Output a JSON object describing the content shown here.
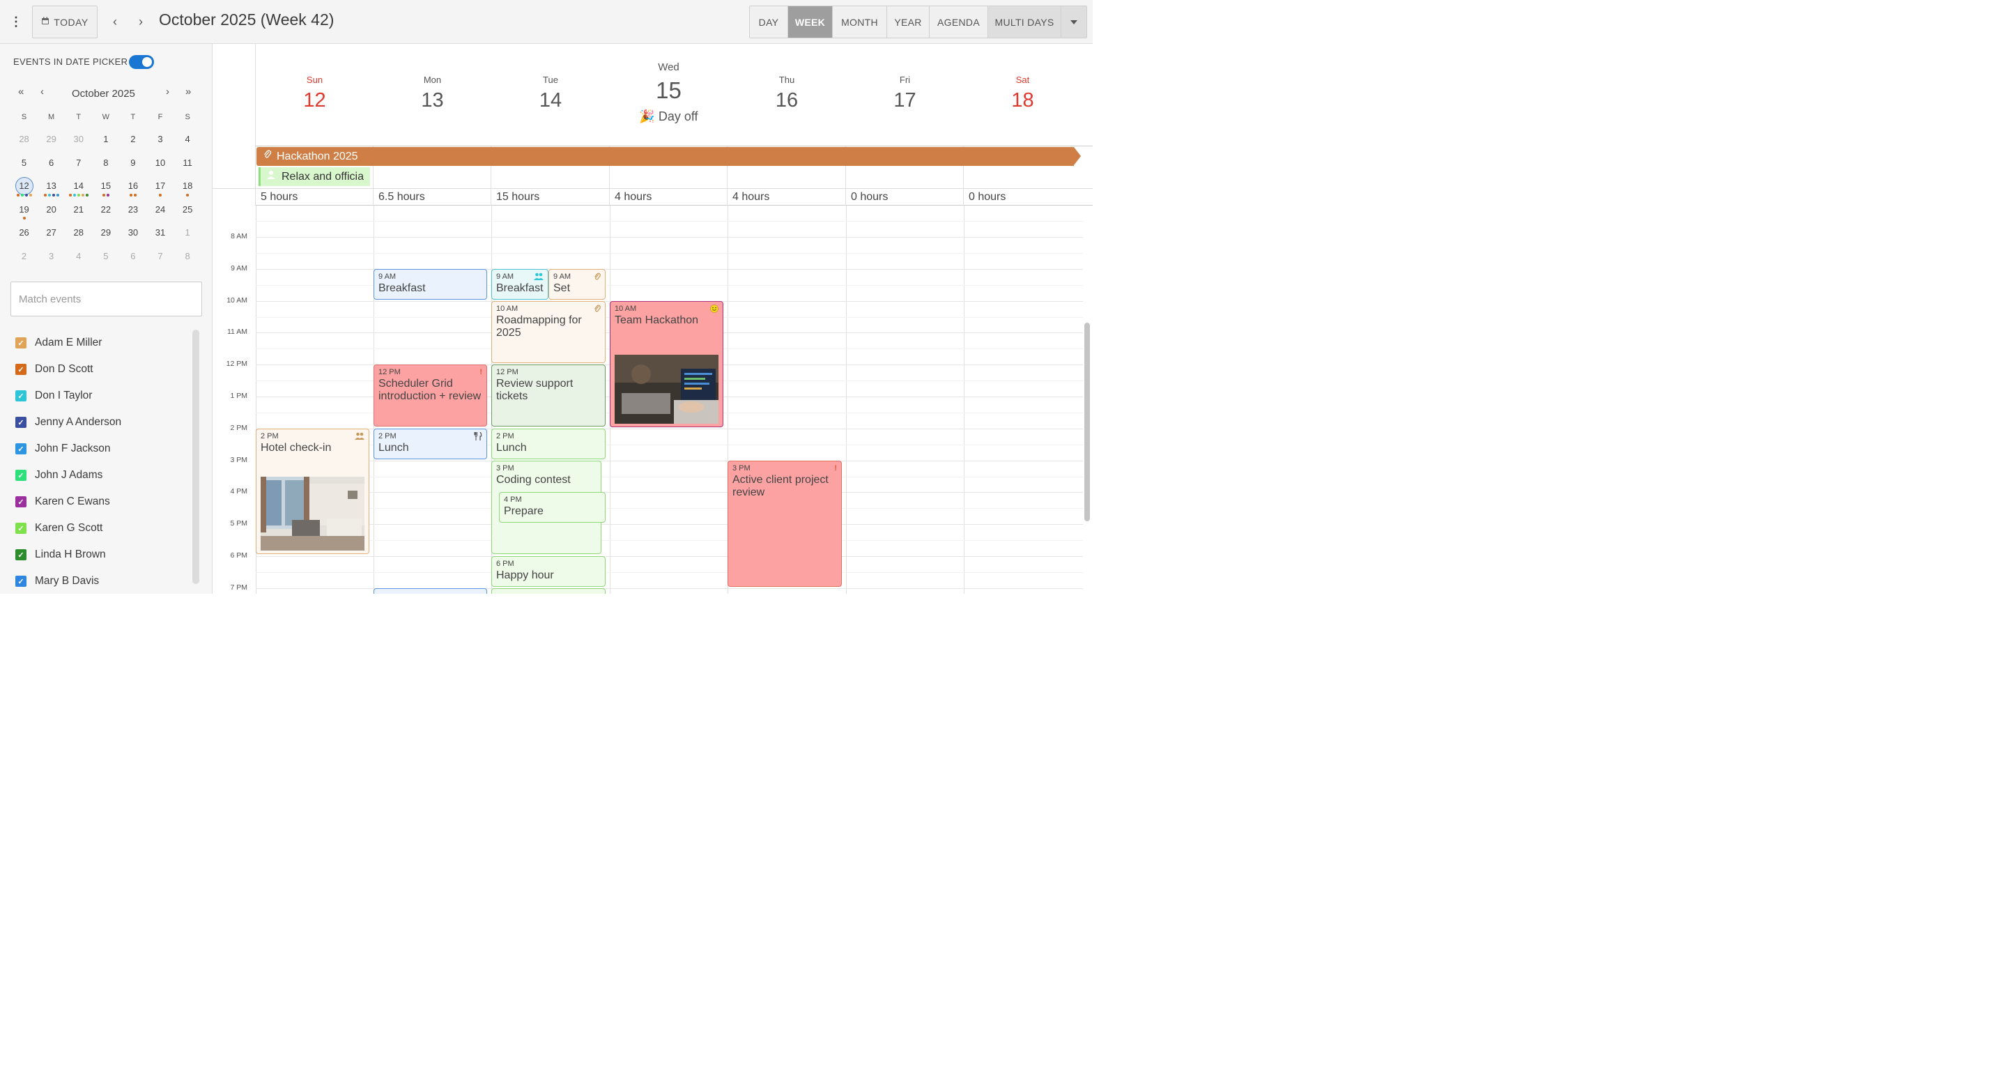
{
  "toolbar": {
    "today_label": "TODAY",
    "title": "October 2025 (Week 42)",
    "views": [
      "DAY",
      "WEEK",
      "MONTH",
      "YEAR",
      "AGENDA",
      "MULTI DAYS"
    ]
  },
  "sidebar": {
    "toggle_label": "EVENTS IN DATE PICKER",
    "calendar_title": "October 2025",
    "dow": [
      "S",
      "M",
      "T",
      "W",
      "T",
      "F",
      "S"
    ],
    "weeks": [
      [
        "28",
        "29",
        "30",
        "1",
        "2",
        "3",
        "4"
      ],
      [
        "5",
        "6",
        "7",
        "8",
        "9",
        "10",
        "11"
      ],
      [
        "12",
        "13",
        "14",
        "15",
        "16",
        "17",
        "18"
      ],
      [
        "19",
        "20",
        "21",
        "22",
        "23",
        "24",
        "25"
      ],
      [
        "26",
        "27",
        "28",
        "29",
        "30",
        "31",
        "1"
      ],
      [
        "2",
        "3",
        "4",
        "5",
        "6",
        "7",
        "8"
      ]
    ],
    "search_placeholder": "Match events",
    "resources": [
      {
        "name": "Adam E Miller",
        "color": "#e0a458"
      },
      {
        "name": "Don D Scott",
        "color": "#d46a1a"
      },
      {
        "name": "Don I Taylor",
        "color": "#2ec6d6"
      },
      {
        "name": "Jenny A Anderson",
        "color": "#3a4fa0"
      },
      {
        "name": "John F Jackson",
        "color": "#2e96e0"
      },
      {
        "name": "John J Adams",
        "color": "#2ee07a"
      },
      {
        "name": "Karen C Ewans",
        "color": "#9b2f9e"
      },
      {
        "name": "Karen G Scott",
        "color": "#7ee04a"
      },
      {
        "name": "Linda H Brown",
        "color": "#2d8c2d"
      },
      {
        "name": "Mary B Davis",
        "color": "#2e86e0"
      }
    ]
  },
  "week": {
    "days": [
      {
        "name": "Sun",
        "num": "12"
      },
      {
        "name": "Mon",
        "num": "13"
      },
      {
        "name": "Tue",
        "num": "14"
      },
      {
        "name": "Wed",
        "num": "15"
      },
      {
        "name": "Thu",
        "num": "16"
      },
      {
        "name": "Fri",
        "num": "17"
      },
      {
        "name": "Sat",
        "num": "18"
      }
    ],
    "day_off_label": "Day off",
    "hours": [
      "5 hours",
      "6.5 hours",
      "15 hours",
      "4 hours",
      "4 hours",
      "0 hours",
      "0 hours"
    ],
    "time_labels": [
      "8 AM",
      "9 AM",
      "10 AM",
      "11 AM",
      "12 PM",
      "1 PM",
      "2 PM",
      "3 PM",
      "4 PM",
      "5 PM",
      "6 PM",
      "7 PM"
    ]
  },
  "allday": {
    "hackathon": "Hackathon 2025",
    "relax": "Relax and officia"
  },
  "events": {
    "breakfast_mon": {
      "time": "9 AM",
      "name": "Breakfast"
    },
    "breakfast_tue": {
      "time": "9 AM",
      "name": "Breakfast"
    },
    "set_tue": {
      "time": "9 AM",
      "name": "Set"
    },
    "roadmap": {
      "time": "10 AM",
      "name": "Roadmapping for 2025"
    },
    "hackathon_team": {
      "time": "10 AM",
      "name": "Team Hackathon"
    },
    "scheduler": {
      "time": "12 PM",
      "name": "Scheduler Grid introduction + review"
    },
    "review": {
      "time": "12 PM",
      "name": "Review support tickets"
    },
    "hotel": {
      "time": "2 PM",
      "name": "Hotel check-in"
    },
    "lunch_mon": {
      "time": "2 PM",
      "name": "Lunch"
    },
    "lunch_tue": {
      "time": "2 PM",
      "name": "Lunch"
    },
    "coding": {
      "time": "3 PM",
      "name": "Coding contest"
    },
    "prepare": {
      "time": "4 PM",
      "name": "Prepare"
    },
    "client": {
      "time": "3 PM",
      "name": "Active client project review"
    },
    "happy": {
      "time": "6 PM",
      "name": "Happy hour"
    }
  },
  "colors": {
    "accent": "#1976d2",
    "weekend": "#e0392d",
    "hackathon": "#cf7f46",
    "red_event": "#fca2a2",
    "green_event": "#effbe9",
    "blue_event": "#eaf3fd",
    "orange_event": "#fdf6ee"
  }
}
